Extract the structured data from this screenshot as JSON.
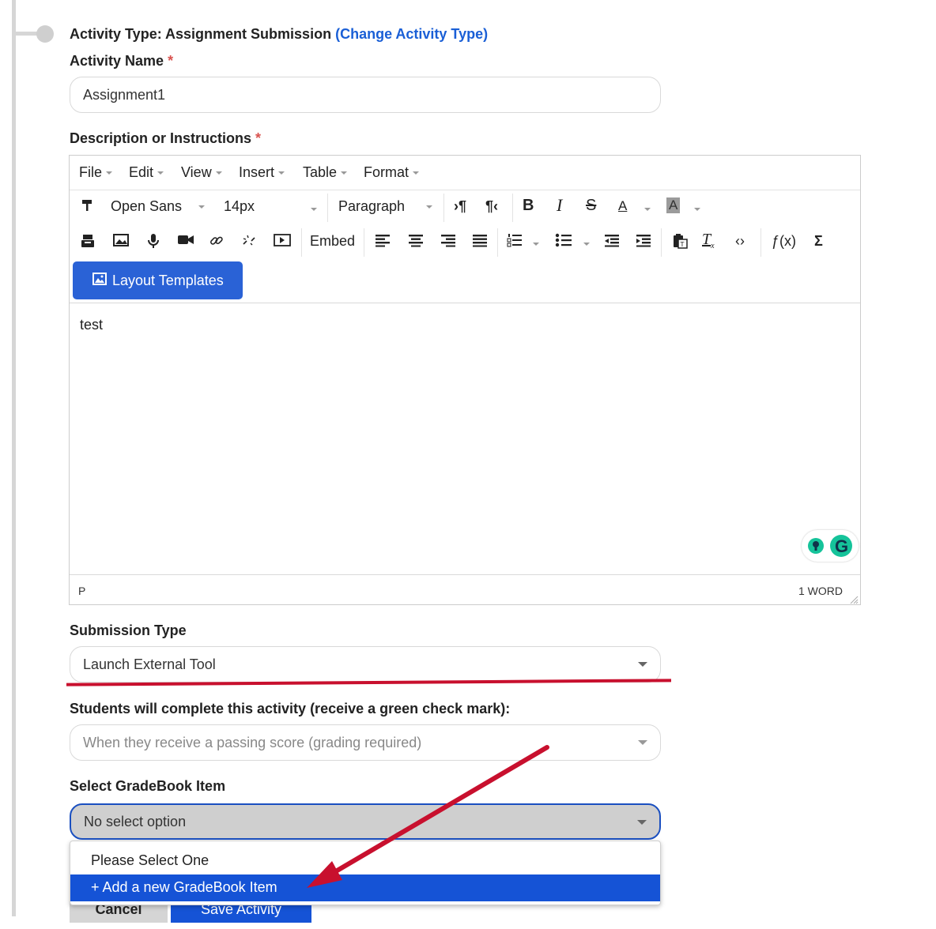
{
  "activity": {
    "type_prefix": "Activity Type: Assignment Submission",
    "change_link": "(Change Activity Type)",
    "name_label": "Activity Name",
    "required_mark": "*",
    "name_value": "Assignment1",
    "description_label": "Description or Instructions"
  },
  "editor": {
    "menus": [
      "File",
      "Edit",
      "View",
      "Insert",
      "Table",
      "Format"
    ],
    "font_family": "Open Sans",
    "font_size": "14px",
    "block_format": "Paragraph",
    "embed_label": "Embed",
    "fx_label": "ƒ(x)",
    "sigma_label": "Σ",
    "layout_templates_label": "Layout Templates",
    "content": "test",
    "path": "P",
    "word_count": "1 WORD"
  },
  "submission": {
    "label": "Submission Type",
    "value": "Launch External Tool"
  },
  "completion": {
    "label": "Students will complete this activity (receive a green check mark):",
    "value": "When they receive a passing score (grading required)"
  },
  "gradebook": {
    "label": "Select GradeBook Item",
    "value": "No select option",
    "options": [
      "Please Select One",
      "+ Add a new GradeBook Item"
    ]
  },
  "footer": {
    "cancel_label": "Cancel",
    "save_label": "Save Activity"
  },
  "colors": {
    "link": "#1a5fd6",
    "primary": "#2a62d6",
    "highlight": "#1553d6",
    "annotation": "#c8102e"
  }
}
